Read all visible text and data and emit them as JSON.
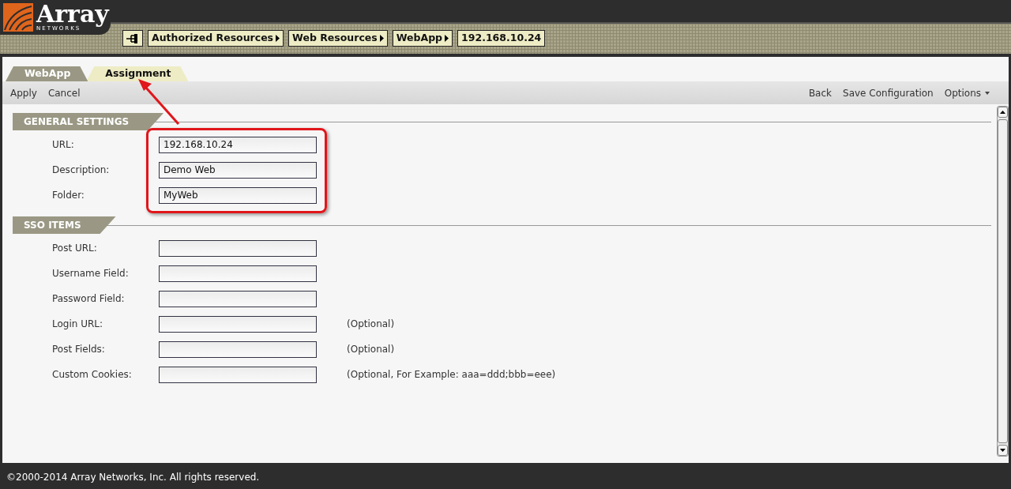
{
  "logo": {
    "text": "Array",
    "subtext": "NETWORKS"
  },
  "breadcrumbs": [
    {
      "label": "Authorized Resources",
      "arrow": true
    },
    {
      "label": "Web Resources",
      "arrow": true
    },
    {
      "label": "WebApp",
      "arrow": true
    },
    {
      "label": "192.168.10.24",
      "arrow": false
    }
  ],
  "tabs": [
    {
      "label": "WebApp",
      "selected": true
    },
    {
      "label": "Assignment",
      "selected": false
    }
  ],
  "toolbar": {
    "left": [
      {
        "label": "Apply",
        "dropdown": false
      },
      {
        "label": "Cancel",
        "dropdown": false
      }
    ],
    "right": [
      {
        "label": "Back",
        "dropdown": false
      },
      {
        "label": "Save Configuration",
        "dropdown": false
      },
      {
        "label": "Options",
        "dropdown": true
      }
    ]
  },
  "sections": [
    {
      "title": "GENERAL SETTINGS",
      "highlighted": true,
      "fields": [
        {
          "label": "URL:",
          "value": "192.168.10.24"
        },
        {
          "label": "Description:",
          "value": "Demo Web"
        },
        {
          "label": "Folder:",
          "value": "MyWeb"
        }
      ]
    },
    {
      "title": "SSO ITEMS",
      "highlighted": false,
      "fields": [
        {
          "label": "Post URL:"
        },
        {
          "label": "Username Field:"
        },
        {
          "label": "Password Field:"
        },
        {
          "label": "Login URL:",
          "note": "(Optional)"
        },
        {
          "label": "Post Fields:",
          "note": "(Optional)"
        },
        {
          "label": "Custom Cookies:",
          "note": "(Optional, For Example: aaa=ddd;bbb=eee)"
        }
      ]
    }
  ],
  "footer": "©2000-2014 Array Networks, Inc. All rights reserved."
}
